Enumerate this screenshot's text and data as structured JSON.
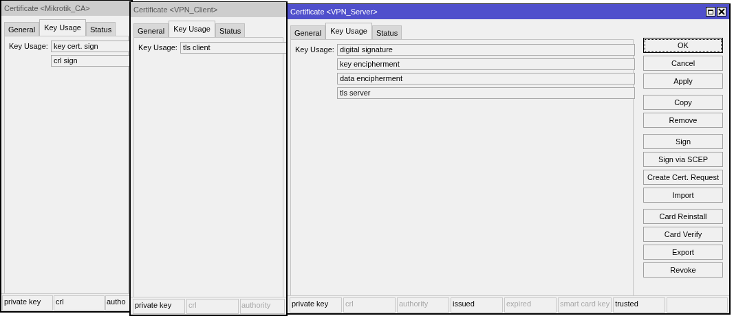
{
  "windows": [
    {
      "title": "Certificate <Mikrotik_CA>",
      "active": false,
      "tabs": [
        {
          "label": "General",
          "selected": false
        },
        {
          "label": "Key Usage",
          "selected": true
        },
        {
          "label": "Status",
          "selected": false
        }
      ],
      "key_usage_label": "Key Usage:",
      "key_usage": [
        "key cert. sign",
        "crl sign"
      ],
      "status_bar": [
        {
          "label": "private key",
          "disabled": false
        },
        {
          "label": "crl",
          "disabled": false
        },
        {
          "label": "autho",
          "disabled": false
        }
      ]
    },
    {
      "title": "Certificate <VPN_Client>",
      "active": false,
      "tabs": [
        {
          "label": "General",
          "selected": false
        },
        {
          "label": "Key Usage",
          "selected": true
        },
        {
          "label": "Status",
          "selected": false
        }
      ],
      "key_usage_label": "Key Usage:",
      "key_usage": [
        "tls client"
      ],
      "status_bar": [
        {
          "label": "private key",
          "disabled": false
        },
        {
          "label": "crl",
          "disabled": true
        },
        {
          "label": "authority",
          "disabled": true
        }
      ]
    },
    {
      "title": "Certificate <VPN_Server>",
      "active": true,
      "tabs": [
        {
          "label": "General",
          "selected": false
        },
        {
          "label": "Key Usage",
          "selected": true
        },
        {
          "label": "Status",
          "selected": false
        }
      ],
      "key_usage_label": "Key Usage:",
      "key_usage": [
        "digital signature",
        "key encipherment",
        "data encipherment",
        "tls server"
      ],
      "buttons": [
        [
          {
            "label": "OK",
            "focused": true
          },
          {
            "label": "Cancel",
            "focused": false
          },
          {
            "label": "Apply",
            "focused": false
          }
        ],
        [
          {
            "label": "Copy",
            "focused": false
          },
          {
            "label": "Remove",
            "focused": false
          }
        ],
        [
          {
            "label": "Sign",
            "focused": false
          },
          {
            "label": "Sign via SCEP",
            "focused": false
          },
          {
            "label": "Create Cert. Request",
            "focused": false
          },
          {
            "label": "Import",
            "focused": false
          }
        ],
        [
          {
            "label": "Card Reinstall",
            "focused": false
          },
          {
            "label": "Card Verify",
            "focused": false
          },
          {
            "label": "Export",
            "focused": false
          },
          {
            "label": "Revoke",
            "focused": false
          }
        ]
      ],
      "status_bar": [
        {
          "label": "private key",
          "disabled": false
        },
        {
          "label": "crl",
          "disabled": true
        },
        {
          "label": "authority",
          "disabled": true
        },
        {
          "label": "issued",
          "disabled": false
        },
        {
          "label": "expired",
          "disabled": true
        },
        {
          "label": "smart card key",
          "disabled": true
        },
        {
          "label": "trusted",
          "disabled": false
        }
      ]
    }
  ]
}
